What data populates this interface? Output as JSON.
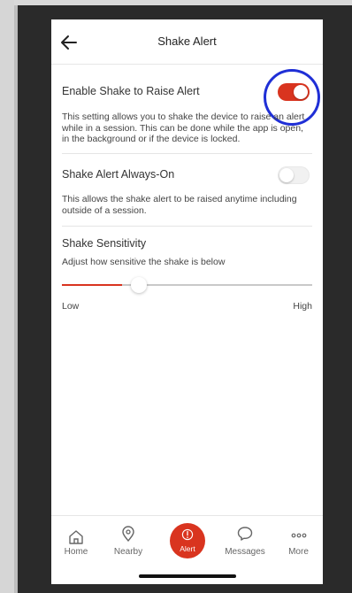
{
  "header": {
    "title": "Shake Alert"
  },
  "settings": {
    "enable_shake": {
      "title": "Enable Shake to Raise Alert",
      "description_lines": [
        "This setting allows you to shake the device to raise an alert",
        "while in a session. This can be done while the app is open,",
        "in the background or if the device is locked."
      ],
      "enabled": true
    },
    "always_on": {
      "title": "Shake Alert Always-On",
      "description_lines": [
        "This allows the shake alert to be raised anytime including",
        "outside of a session."
      ],
      "enabled": false
    },
    "sensitivity": {
      "title": "Shake Sensitivity",
      "description": "Adjust how sensitive the shake is below",
      "min_label": "Low",
      "max_label": "High",
      "value_fraction": 0.24
    }
  },
  "tabbar": {
    "tabs": [
      {
        "label": "Home",
        "icon": "home-icon"
      },
      {
        "label": "Nearby",
        "icon": "location-pin-icon"
      },
      {
        "label": "Alert",
        "icon": "alert-exclamation-icon"
      },
      {
        "label": "Messages",
        "icon": "chat-bubble-icon"
      },
      {
        "label": "More",
        "icon": "more-dots-icon"
      }
    ]
  },
  "colors": {
    "accent": "#d9341f",
    "highlight_ring": "#1f2fd6"
  }
}
